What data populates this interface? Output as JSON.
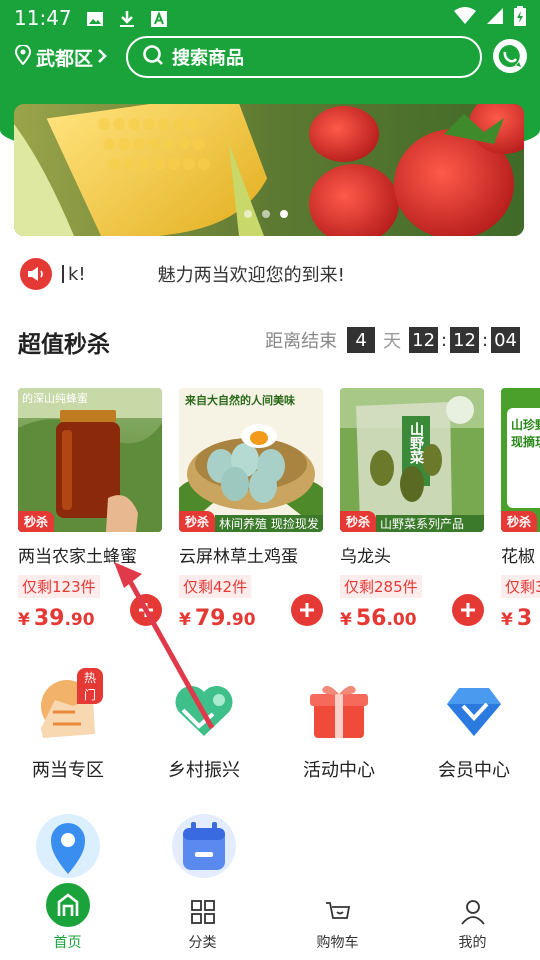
{
  "status_bar": {
    "time": "11:47",
    "icons": [
      "image-icon",
      "download-icon",
      "font-icon",
      "wifi-icon",
      "signal-icon",
      "battery-icon"
    ]
  },
  "header": {
    "location": "武都区",
    "search_label": "搜索商品",
    "message_icon": "chat-icon"
  },
  "banner": {
    "dots": 3,
    "active_dot": 2
  },
  "notice": {
    "tag": "k!",
    "text": "魅力两当欢迎您的到来!"
  },
  "flash_sale": {
    "title": "超值秒杀",
    "countdown_label": "距离结束",
    "days": "4",
    "days_unit": "天",
    "hours": "12",
    "minutes": "12",
    "seconds": "04",
    "badge": "秒杀",
    "products": [
      {
        "name": "两当农家土蜂蜜",
        "stock": "仅剩123件",
        "price_int": "39",
        "price_dec": ".90",
        "img_caption": "的深山纯蜂蜜",
        "strip": ""
      },
      {
        "name": "云屏林草土鸡蛋",
        "stock": "仅剩42件",
        "price_int": "79",
        "price_dec": ".90",
        "img_caption": "来自大自然的人间美味",
        "strip": "林间养殖 现捡现发"
      },
      {
        "name": "乌龙头",
        "stock": "仅剩285件",
        "price_int": "56",
        "price_dec": ".00",
        "img_caption": "山野菜",
        "strip": "山野菜系列产品"
      },
      {
        "name": "花椒",
        "stock": "仅剩3",
        "price_int": "3",
        "price_dec": "",
        "img_caption": "山珍野 现摘现",
        "strip": ""
      }
    ],
    "currency": "¥"
  },
  "categories": [
    {
      "label": "两当专区",
      "icon": "map-region-icon",
      "hot": "热门"
    },
    {
      "label": "乡村振兴",
      "icon": "heart-handshake-icon",
      "hot": ""
    },
    {
      "label": "活动中心",
      "icon": "gift-icon",
      "hot": ""
    },
    {
      "label": "会员中心",
      "icon": "diamond-icon",
      "hot": ""
    },
    {
      "label": "",
      "icon": "location-pin-icon",
      "hot": ""
    },
    {
      "label": "",
      "icon": "calendar-icon",
      "hot": ""
    }
  ],
  "bottom_nav": [
    {
      "label": "首页",
      "icon": "home-icon",
      "active": true
    },
    {
      "label": "分类",
      "icon": "grid-icon",
      "active": false
    },
    {
      "label": "购物车",
      "icon": "cart-icon",
      "active": false
    },
    {
      "label": "我的",
      "icon": "user-icon",
      "active": false
    }
  ],
  "colors": {
    "brand_green": "#1aa33a",
    "accent_red": "#e53935"
  }
}
